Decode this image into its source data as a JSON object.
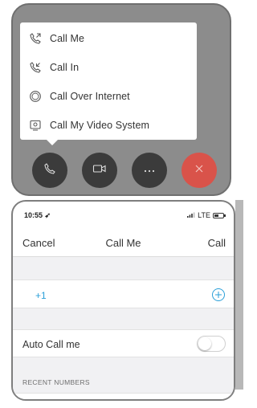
{
  "call_options_menu": {
    "items": [
      {
        "label": "Call Me",
        "icon": "phone-outgoing-icon"
      },
      {
        "label": "Call In",
        "icon": "phone-incoming-icon"
      },
      {
        "label": "Call Over Internet",
        "icon": "internet-call-icon"
      },
      {
        "label": "Call My Video System",
        "icon": "video-system-icon"
      }
    ]
  },
  "call_controls": {
    "buttons": [
      "phone-icon",
      "video-camera-icon",
      "more-icon",
      "close-icon"
    ],
    "end_color": "#d9534a"
  },
  "status_bar": {
    "time": "10:55",
    "network": "LTE"
  },
  "nav": {
    "cancel_label": "Cancel",
    "title": "Call Me",
    "call_label": "Call"
  },
  "phone_number": {
    "country_code": "+1",
    "value": ""
  },
  "auto_call_me": {
    "label": "Auto Call me",
    "enabled": false
  },
  "recent_numbers": {
    "header": "RECENT NUMBERS"
  },
  "colors": {
    "accent": "#2a9fd8",
    "overlay_gray": "#8c8c8c"
  }
}
